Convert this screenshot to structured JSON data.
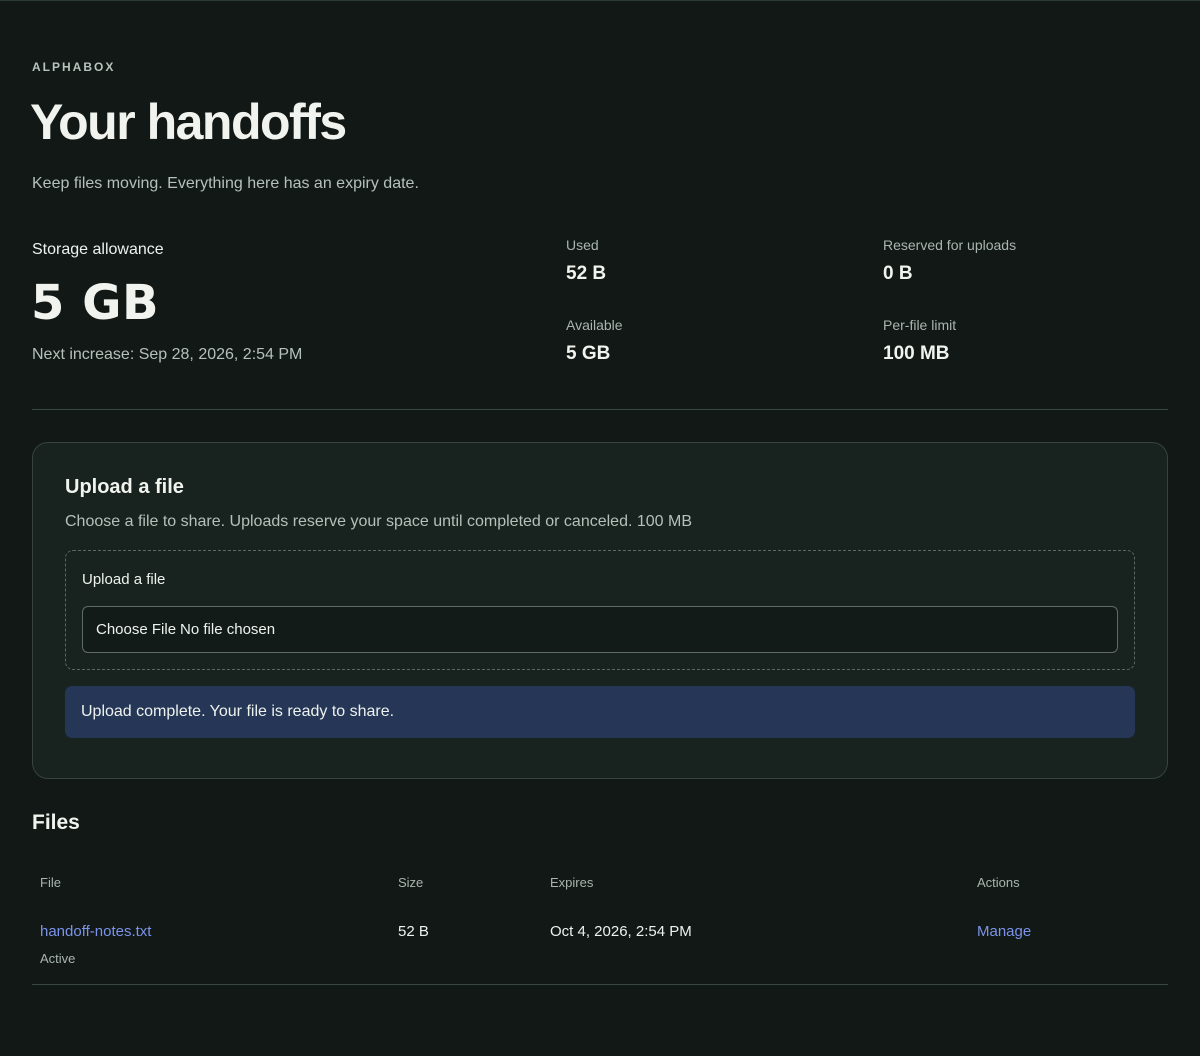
{
  "brand": "ALPHABOX",
  "page_title": "Your handoffs",
  "subtitle": "Keep files moving. Everything here has an expiry date.",
  "storage": {
    "label": "Storage allowance",
    "value": "5 GB",
    "next_increase": "Next increase: Sep 28, 2026, 2:54 PM",
    "stats": {
      "used": {
        "label": "Used",
        "value": "52 B"
      },
      "reserved": {
        "label": "Reserved for uploads",
        "value": "0 B"
      },
      "available": {
        "label": "Available",
        "value": "5 GB"
      },
      "per_file_limit": {
        "label": "Per-file limit",
        "value": "100 MB"
      }
    }
  },
  "upload": {
    "title": "Upload a file",
    "description": "Choose a file to share. Uploads reserve your space until completed or canceled. 100 MB",
    "field_label": "Upload a file",
    "choose_button": "Choose File",
    "no_file_text": "No file chosen",
    "alert": "Upload complete. Your file is ready to share."
  },
  "files": {
    "title": "Files",
    "columns": {
      "file": "File",
      "size": "Size",
      "expires": "Expires",
      "actions": "Actions"
    },
    "rows": [
      {
        "name": "handoff-notes.txt",
        "status": "Active",
        "size": "52 B",
        "expires": "Oct 4, 2026, 2:54 PM",
        "action": "Manage"
      }
    ]
  },
  "colors": {
    "background": "#111816",
    "card": "#18221e",
    "link": "#7b93ea",
    "alert": "#253656"
  }
}
